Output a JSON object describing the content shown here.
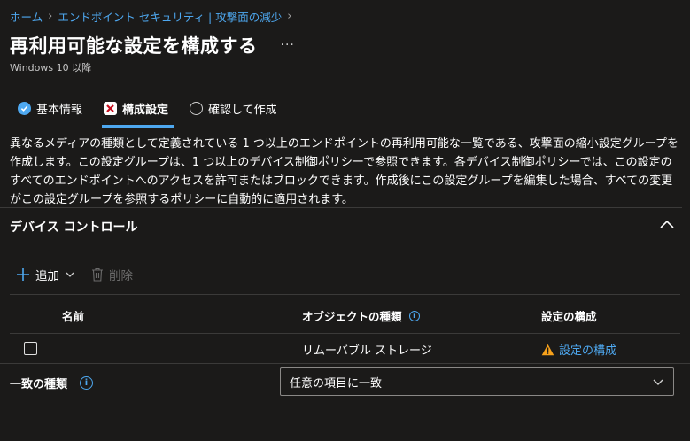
{
  "breadcrumb": {
    "home": "ホーム",
    "section": "エンドポイント セキュリティ | 攻撃面の減少"
  },
  "header": {
    "title": "再利用可能な設定を構成する",
    "more": "···",
    "subtitle": "Windows 10 以降"
  },
  "steps": [
    {
      "label": "基本情報",
      "status": "done"
    },
    {
      "label": "構成設定",
      "status": "error"
    },
    {
      "label": "確認して作成",
      "status": "pending"
    }
  ],
  "description": "異なるメディアの種類として定義されている 1 つ以上のエンドポイントの再利用可能な一覧である、攻撃面の縮小設定グループを作成します。この設定グループは、1 つ以上のデバイス制御ポリシーで参照できます。各デバイス制御ポリシーでは、この設定のすべてのエンドポイントへのアクセスを許可またはブロックできます。作成後にこの設定グループを編集した場合、すべての変更がこの設定グループを参照するポリシーに自動的に適用されます。",
  "section": {
    "title": "デバイス コントロール"
  },
  "toolbar": {
    "add": "追加",
    "delete": "削除"
  },
  "table": {
    "headers": {
      "name": "名前",
      "object_type": "オブジェクトの種類",
      "config": "設定の構成"
    },
    "rows": [
      {
        "name": "",
        "object_type": "リムーバブル ストレージ",
        "config": "設定の構成"
      }
    ]
  },
  "match": {
    "label": "一致の種類",
    "value": "任意の項目に一致"
  },
  "colors": {
    "background": "#1b1a19",
    "accent": "#4ea8f0",
    "error": "#c50f1f",
    "warning": "#f7a11b"
  }
}
